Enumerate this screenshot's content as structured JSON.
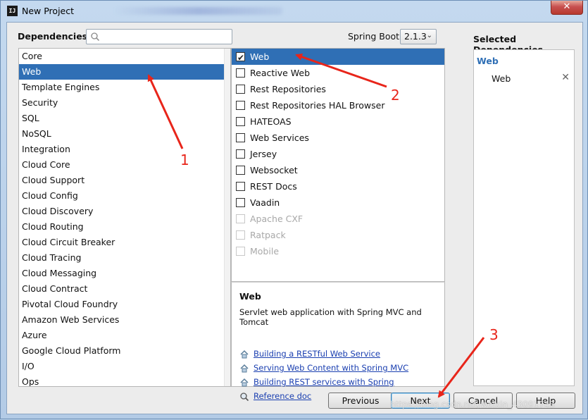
{
  "window": {
    "title": "New Project",
    "close_glyph": "✕",
    "app_icon_text": "IJ"
  },
  "header": {
    "dependencies_label": "Dependencies",
    "search_placeholder": "",
    "spring_boot_label": "Spring Boot",
    "spring_boot_version": "2.1.3",
    "selected_title": "Selected Dependencies"
  },
  "categories": [
    "Core",
    "Web",
    "Template Engines",
    "Security",
    "SQL",
    "NoSQL",
    "Integration",
    "Cloud Core",
    "Cloud Support",
    "Cloud Config",
    "Cloud Discovery",
    "Cloud Routing",
    "Cloud Circuit Breaker",
    "Cloud Tracing",
    "Cloud Messaging",
    "Cloud Contract",
    "Pivotal Cloud Foundry",
    "Amazon Web Services",
    "Azure",
    "Google Cloud Platform",
    "I/O",
    "Ops"
  ],
  "selected_category": "Web",
  "dependencies": [
    {
      "label": "Web",
      "checked": true,
      "selected": true,
      "disabled": false
    },
    {
      "label": "Reactive Web",
      "checked": false,
      "selected": false,
      "disabled": false
    },
    {
      "label": "Rest Repositories",
      "checked": false,
      "selected": false,
      "disabled": false
    },
    {
      "label": "Rest Repositories HAL Browser",
      "checked": false,
      "selected": false,
      "disabled": false
    },
    {
      "label": "HATEOAS",
      "checked": false,
      "selected": false,
      "disabled": false
    },
    {
      "label": "Web Services",
      "checked": false,
      "selected": false,
      "disabled": false
    },
    {
      "label": "Jersey",
      "checked": false,
      "selected": false,
      "disabled": false
    },
    {
      "label": "Websocket",
      "checked": false,
      "selected": false,
      "disabled": false
    },
    {
      "label": "REST Docs",
      "checked": false,
      "selected": false,
      "disabled": false
    },
    {
      "label": "Vaadin",
      "checked": false,
      "selected": false,
      "disabled": false
    },
    {
      "label": "Apache CXF",
      "checked": false,
      "selected": false,
      "disabled": true
    },
    {
      "label": "Ratpack",
      "checked": false,
      "selected": false,
      "disabled": true
    },
    {
      "label": "Mobile",
      "checked": false,
      "selected": false,
      "disabled": true
    }
  ],
  "description": {
    "title": "Web",
    "text": "Servlet web application with Spring MVC and Tomcat",
    "guides": [
      {
        "label": "Building a RESTful Web Service",
        "icon": "home-icon"
      },
      {
        "label": "Serving Web Content with Spring MVC",
        "icon": "home-icon"
      },
      {
        "label": "Building REST services with Spring",
        "icon": "home-icon"
      },
      {
        "label": "Reference doc",
        "icon": "reference-doc-icon"
      }
    ]
  },
  "selected": {
    "group": "Web",
    "items": [
      {
        "label": "Web",
        "remove_glyph": "✕"
      }
    ]
  },
  "buttons": {
    "previous": "Previous",
    "next": "Next",
    "cancel": "Cancel",
    "help": "Help"
  },
  "annotations": {
    "one": "1",
    "two": "2",
    "three": "3",
    "color": "#e8251a"
  },
  "watermark": "https://blog.csdn.net/weixin_43091743",
  "colors": {
    "selection": "#2f6fb5",
    "link": "#1a3fb0"
  }
}
